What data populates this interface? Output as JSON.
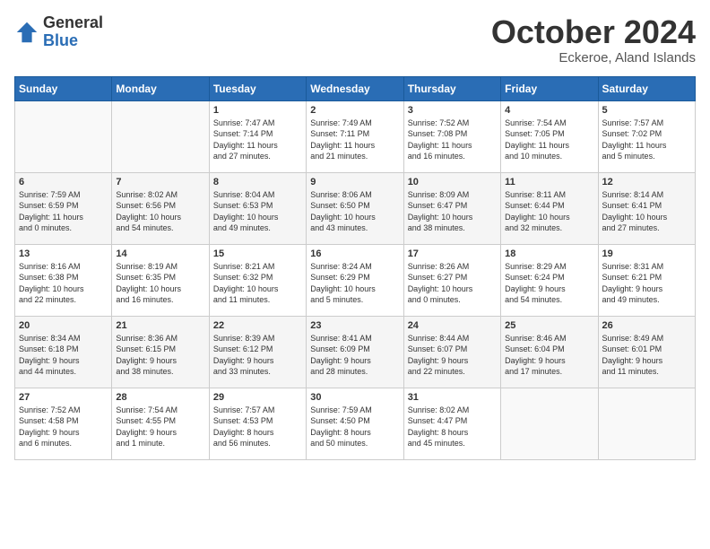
{
  "logo": {
    "general": "General",
    "blue": "Blue"
  },
  "title": "October 2024",
  "subtitle": "Eckeroe, Aland Islands",
  "days_header": [
    "Sunday",
    "Monday",
    "Tuesday",
    "Wednesday",
    "Thursday",
    "Friday",
    "Saturday"
  ],
  "weeks": [
    [
      {
        "day": "",
        "info": ""
      },
      {
        "day": "",
        "info": ""
      },
      {
        "day": "1",
        "info": "Sunrise: 7:47 AM\nSunset: 7:14 PM\nDaylight: 11 hours\nand 27 minutes."
      },
      {
        "day": "2",
        "info": "Sunrise: 7:49 AM\nSunset: 7:11 PM\nDaylight: 11 hours\nand 21 minutes."
      },
      {
        "day": "3",
        "info": "Sunrise: 7:52 AM\nSunset: 7:08 PM\nDaylight: 11 hours\nand 16 minutes."
      },
      {
        "day": "4",
        "info": "Sunrise: 7:54 AM\nSunset: 7:05 PM\nDaylight: 11 hours\nand 10 minutes."
      },
      {
        "day": "5",
        "info": "Sunrise: 7:57 AM\nSunset: 7:02 PM\nDaylight: 11 hours\nand 5 minutes."
      }
    ],
    [
      {
        "day": "6",
        "info": "Sunrise: 7:59 AM\nSunset: 6:59 PM\nDaylight: 11 hours\nand 0 minutes."
      },
      {
        "day": "7",
        "info": "Sunrise: 8:02 AM\nSunset: 6:56 PM\nDaylight: 10 hours\nand 54 minutes."
      },
      {
        "day": "8",
        "info": "Sunrise: 8:04 AM\nSunset: 6:53 PM\nDaylight: 10 hours\nand 49 minutes."
      },
      {
        "day": "9",
        "info": "Sunrise: 8:06 AM\nSunset: 6:50 PM\nDaylight: 10 hours\nand 43 minutes."
      },
      {
        "day": "10",
        "info": "Sunrise: 8:09 AM\nSunset: 6:47 PM\nDaylight: 10 hours\nand 38 minutes."
      },
      {
        "day": "11",
        "info": "Sunrise: 8:11 AM\nSunset: 6:44 PM\nDaylight: 10 hours\nand 32 minutes."
      },
      {
        "day": "12",
        "info": "Sunrise: 8:14 AM\nSunset: 6:41 PM\nDaylight: 10 hours\nand 27 minutes."
      }
    ],
    [
      {
        "day": "13",
        "info": "Sunrise: 8:16 AM\nSunset: 6:38 PM\nDaylight: 10 hours\nand 22 minutes."
      },
      {
        "day": "14",
        "info": "Sunrise: 8:19 AM\nSunset: 6:35 PM\nDaylight: 10 hours\nand 16 minutes."
      },
      {
        "day": "15",
        "info": "Sunrise: 8:21 AM\nSunset: 6:32 PM\nDaylight: 10 hours\nand 11 minutes."
      },
      {
        "day": "16",
        "info": "Sunrise: 8:24 AM\nSunset: 6:29 PM\nDaylight: 10 hours\nand 5 minutes."
      },
      {
        "day": "17",
        "info": "Sunrise: 8:26 AM\nSunset: 6:27 PM\nDaylight: 10 hours\nand 0 minutes."
      },
      {
        "day": "18",
        "info": "Sunrise: 8:29 AM\nSunset: 6:24 PM\nDaylight: 9 hours\nand 54 minutes."
      },
      {
        "day": "19",
        "info": "Sunrise: 8:31 AM\nSunset: 6:21 PM\nDaylight: 9 hours\nand 49 minutes."
      }
    ],
    [
      {
        "day": "20",
        "info": "Sunrise: 8:34 AM\nSunset: 6:18 PM\nDaylight: 9 hours\nand 44 minutes."
      },
      {
        "day": "21",
        "info": "Sunrise: 8:36 AM\nSunset: 6:15 PM\nDaylight: 9 hours\nand 38 minutes."
      },
      {
        "day": "22",
        "info": "Sunrise: 8:39 AM\nSunset: 6:12 PM\nDaylight: 9 hours\nand 33 minutes."
      },
      {
        "day": "23",
        "info": "Sunrise: 8:41 AM\nSunset: 6:09 PM\nDaylight: 9 hours\nand 28 minutes."
      },
      {
        "day": "24",
        "info": "Sunrise: 8:44 AM\nSunset: 6:07 PM\nDaylight: 9 hours\nand 22 minutes."
      },
      {
        "day": "25",
        "info": "Sunrise: 8:46 AM\nSunset: 6:04 PM\nDaylight: 9 hours\nand 17 minutes."
      },
      {
        "day": "26",
        "info": "Sunrise: 8:49 AM\nSunset: 6:01 PM\nDaylight: 9 hours\nand 11 minutes."
      }
    ],
    [
      {
        "day": "27",
        "info": "Sunrise: 7:52 AM\nSunset: 4:58 PM\nDaylight: 9 hours\nand 6 minutes."
      },
      {
        "day": "28",
        "info": "Sunrise: 7:54 AM\nSunset: 4:55 PM\nDaylight: 9 hours\nand 1 minute."
      },
      {
        "day": "29",
        "info": "Sunrise: 7:57 AM\nSunset: 4:53 PM\nDaylight: 8 hours\nand 56 minutes."
      },
      {
        "day": "30",
        "info": "Sunrise: 7:59 AM\nSunset: 4:50 PM\nDaylight: 8 hours\nand 50 minutes."
      },
      {
        "day": "31",
        "info": "Sunrise: 8:02 AM\nSunset: 4:47 PM\nDaylight: 8 hours\nand 45 minutes."
      },
      {
        "day": "",
        "info": ""
      },
      {
        "day": "",
        "info": ""
      }
    ]
  ]
}
